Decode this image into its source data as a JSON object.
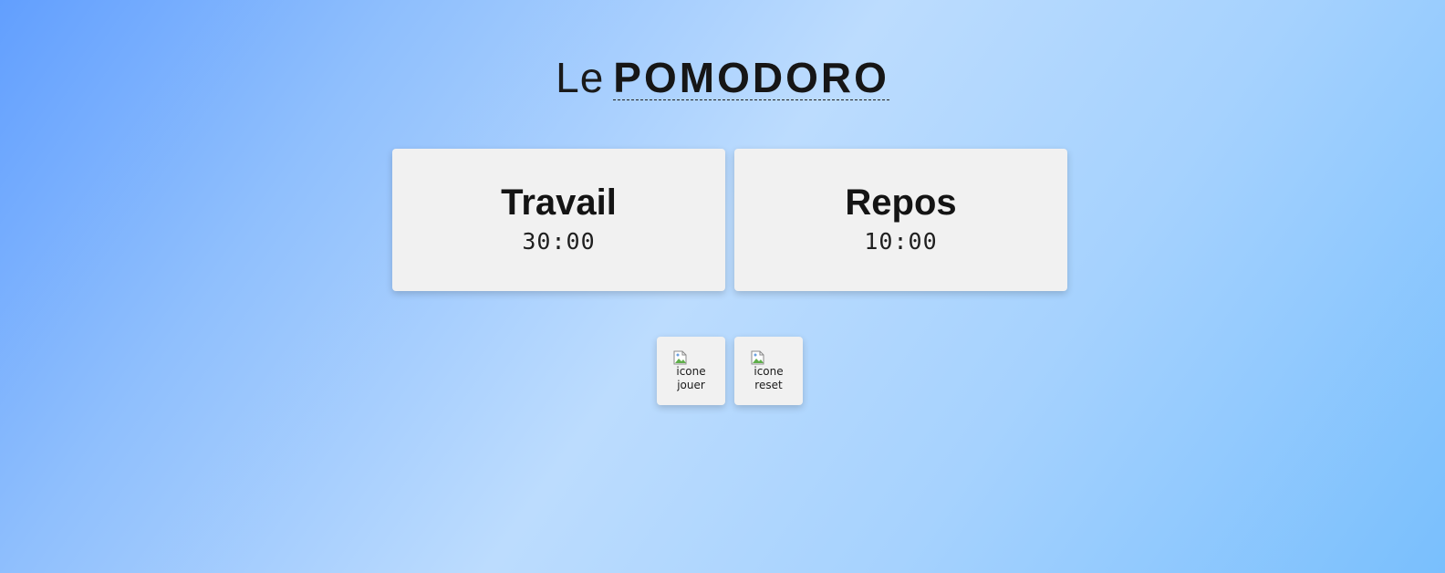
{
  "header": {
    "title_prefix": "Le",
    "title_main": "POMODORO"
  },
  "timers": [
    {
      "label": "Travail",
      "time": "30:00"
    },
    {
      "label": "Repos",
      "time": "10:00"
    }
  ],
  "controls": {
    "play_alt": "icone jouer",
    "reset_alt": "icone reset",
    "broken_icon": "broken-image-icon"
  }
}
